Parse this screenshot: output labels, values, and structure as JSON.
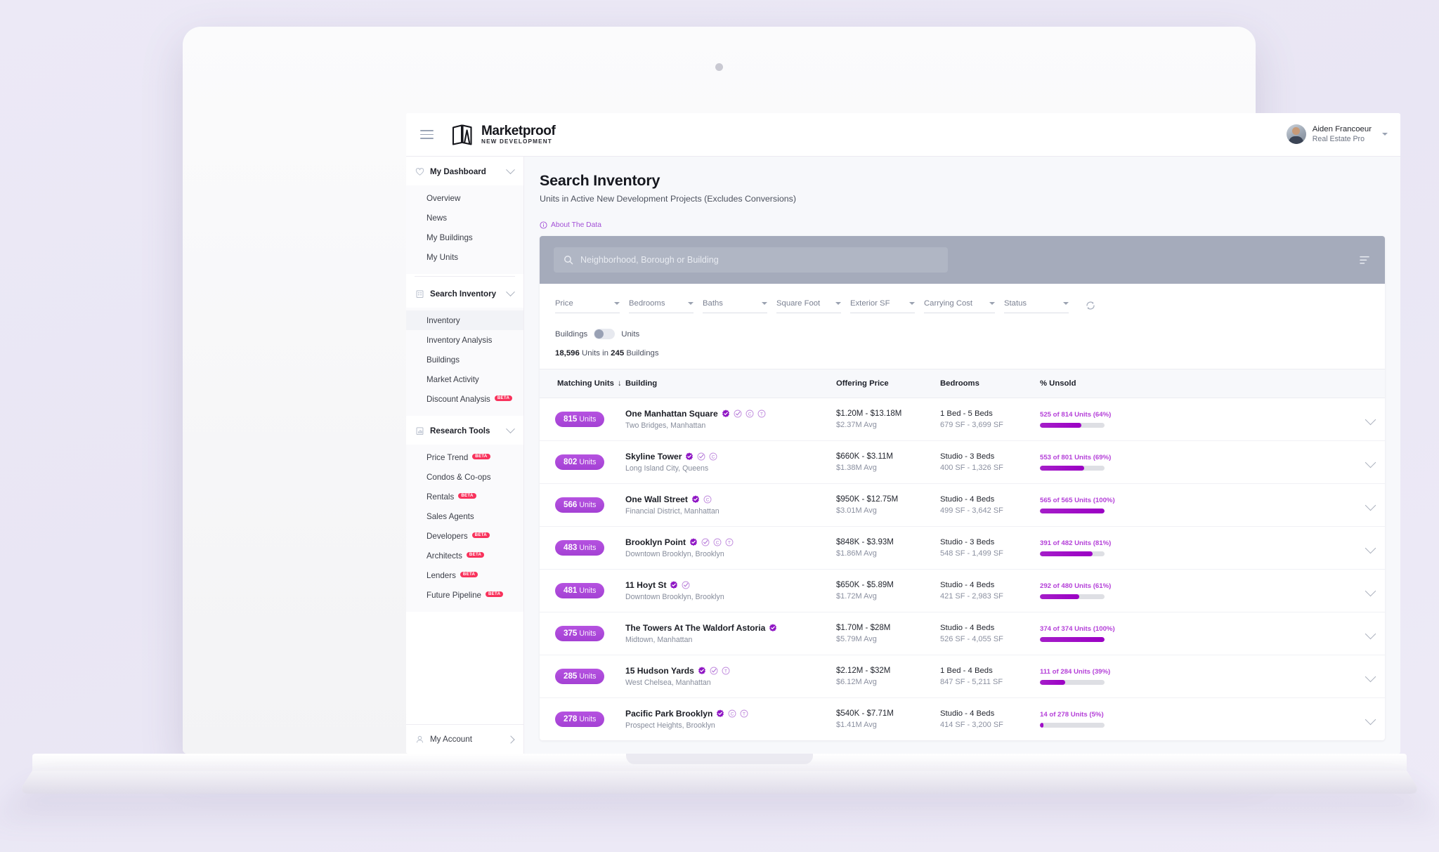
{
  "header": {
    "menu_icon": "hamburger-icon",
    "brand_name": "Marketproof",
    "brand_sub": "NEW DEVELOPMENT",
    "user_name": "Aiden Francoeur",
    "user_role": "Real Estate Pro"
  },
  "sidebar": {
    "groups": [
      {
        "label": "My Dashboard",
        "icon": "heart-icon",
        "items": [
          {
            "label": "Overview",
            "beta": ""
          },
          {
            "label": "News",
            "beta": ""
          },
          {
            "label": "My Buildings",
            "beta": ""
          },
          {
            "label": "My Units",
            "beta": ""
          }
        ]
      },
      {
        "label": "Search Inventory",
        "icon": "building-icon",
        "items": [
          {
            "label": "Inventory",
            "beta": "",
            "active": true
          },
          {
            "label": "Inventory Analysis",
            "beta": ""
          },
          {
            "label": "Buildings",
            "beta": ""
          },
          {
            "label": "Market Activity",
            "beta": ""
          },
          {
            "label": "Discount Analysis",
            "beta": "BETA"
          }
        ]
      },
      {
        "label": "Research Tools",
        "icon": "chart-icon",
        "items": [
          {
            "label": "Price Trend",
            "beta": "BETA"
          },
          {
            "label": "Condos & Co-ops",
            "beta": ""
          },
          {
            "label": "Rentals",
            "beta": "BETA"
          },
          {
            "label": "Sales Agents",
            "beta": ""
          },
          {
            "label": "Developers",
            "beta": "BETA"
          },
          {
            "label": "Architects",
            "beta": "BETA"
          },
          {
            "label": "Lenders",
            "beta": "BETA"
          },
          {
            "label": "Future Pipeline",
            "beta": "BETA"
          }
        ]
      }
    ],
    "footer": {
      "label": "My Account",
      "icon": "user-icon"
    }
  },
  "main": {
    "title": "Search Inventory",
    "subtitle": "Units in Active New Development Projects (Excludes Conversions)",
    "about_link": "About The Data",
    "search": {
      "placeholder": "Neighborhood, Borough or Building",
      "value": ""
    },
    "filters": [
      {
        "label": "Price"
      },
      {
        "label": "Bedrooms"
      },
      {
        "label": "Baths"
      },
      {
        "label": "Square Foot"
      },
      {
        "label": "Exterior SF"
      },
      {
        "label": "Carrying Cost"
      },
      {
        "label": "Status"
      }
    ],
    "toggle": {
      "left_label": "Buildings",
      "right_label": "Units",
      "state": "left"
    },
    "count_prefix": "18,596",
    "count_mid": " Units in ",
    "count_num2": "245",
    "count_suffix": " Buildings",
    "columns": [
      {
        "label": "Matching Units",
        "sorted": "desc",
        "sort_glyph": "↓"
      },
      {
        "label": "Building"
      },
      {
        "label": "Offering Price"
      },
      {
        "label": "Bedrooms"
      },
      {
        "label": "% Unsold"
      }
    ],
    "rows": [
      {
        "units_num": "815",
        "units_word": "Units",
        "building": "One Manhattan Square",
        "location": "Two Bridges, Manhattan",
        "badges": [
          "verified-badge",
          "check-circle-badge",
          "c-circle-badge",
          "t-circle-badge"
        ],
        "price_range": "$1.20M - $13.18M",
        "price_avg": "$2.37M Avg",
        "beds": "1 Bed - 5 Beds",
        "sf": "679 SF - 3,699 SF",
        "unsold_label": "525 of 814 Units (64%)",
        "unsold_pct": 64
      },
      {
        "units_num": "802",
        "units_word": "Units",
        "building": "Skyline Tower",
        "location": "Long Island City, Queens",
        "badges": [
          "verified-badge",
          "check-circle-badge",
          "c-circle-badge"
        ],
        "price_range": "$660K - $3.11M",
        "price_avg": "$1.38M Avg",
        "beds": "Studio - 3 Beds",
        "sf": "400 SF - 1,326 SF",
        "unsold_label": "553 of 801 Units (69%)",
        "unsold_pct": 69
      },
      {
        "units_num": "566",
        "units_word": "Units",
        "building": "One Wall Street",
        "location": "Financial District, Manhattan",
        "badges": [
          "verified-badge",
          "c-circle-badge"
        ],
        "price_range": "$950K - $12.75M",
        "price_avg": "$3.01M Avg",
        "beds": "Studio - 4 Beds",
        "sf": "499 SF - 3,642 SF",
        "unsold_label": "565 of 565 Units (100%)",
        "unsold_pct": 100
      },
      {
        "units_num": "483",
        "units_word": "Units",
        "building": "Brooklyn Point",
        "location": "Downtown Brooklyn, Brooklyn",
        "badges": [
          "verified-badge",
          "check-circle-badge",
          "c-circle-badge",
          "t-circle-badge"
        ],
        "price_range": "$848K - $3.93M",
        "price_avg": "$1.86M Avg",
        "beds": "Studio - 3 Beds",
        "sf": "548 SF - 1,499 SF",
        "unsold_label": "391 of 482 Units (81%)",
        "unsold_pct": 81
      },
      {
        "units_num": "481",
        "units_word": "Units",
        "building": "11 Hoyt St",
        "location": "Downtown Brooklyn, Brooklyn",
        "badges": [
          "verified-badge",
          "check-circle-badge"
        ],
        "price_range": "$650K - $5.89M",
        "price_avg": "$1.72M Avg",
        "beds": "Studio - 4 Beds",
        "sf": "421 SF - 2,983 SF",
        "unsold_label": "292 of 480 Units (61%)",
        "unsold_pct": 61
      },
      {
        "units_num": "375",
        "units_word": "Units",
        "building": "The Towers At The Waldorf Astoria",
        "location": "Midtown, Manhattan",
        "badges": [
          "verified-badge"
        ],
        "price_range": "$1.70M - $28M",
        "price_avg": "$5.79M Avg",
        "beds": "Studio - 4 Beds",
        "sf": "526 SF - 4,055 SF",
        "unsold_label": "374 of 374 Units (100%)",
        "unsold_pct": 100
      },
      {
        "units_num": "285",
        "units_word": "Units",
        "building": "15 Hudson Yards",
        "location": "West Chelsea, Manhattan",
        "badges": [
          "verified-badge",
          "check-circle-badge",
          "t-circle-badge"
        ],
        "price_range": "$2.12M - $32M",
        "price_avg": "$6.12M Avg",
        "beds": "1 Bed - 4 Beds",
        "sf": "847 SF - 5,211 SF",
        "unsold_label": "111 of 284 Units (39%)",
        "unsold_pct": 39
      },
      {
        "units_num": "278",
        "units_word": "Units",
        "building": "Pacific Park Brooklyn",
        "location": "Prospect Heights, Brooklyn",
        "badges": [
          "verified-badge",
          "c-circle-badge",
          "t-circle-badge"
        ],
        "price_range": "$540K - $7.71M",
        "price_avg": "$1.41M Avg",
        "beds": "Studio - 4 Beds",
        "sf": "414 SF - 3,200 SF",
        "unsold_label": "14 of 278 Units (5%)",
        "unsold_pct": 5
      }
    ]
  },
  "colors": {
    "accent_purple": "#a441d4",
    "bar_purple": "#9b00c4",
    "beta_red": "#f8325c",
    "searchbar_gray": "#a5abbb"
  }
}
